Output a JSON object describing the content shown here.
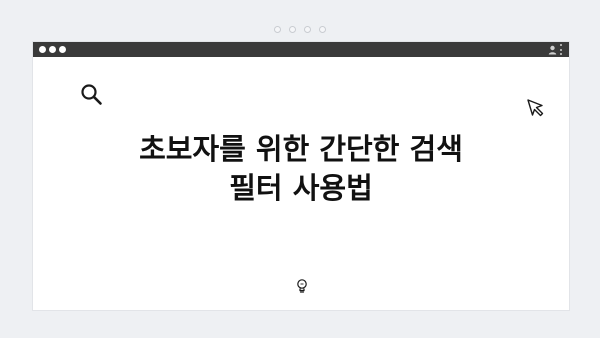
{
  "colors": {
    "background": "#f0f2f5",
    "window": "#ffffff",
    "titlebar": "#3a3a3a",
    "text": "#111111"
  },
  "titlebar": {
    "window_controls": [
      "dot",
      "dot",
      "dot"
    ],
    "right_icons": [
      "user-icon",
      "kebab-menu-icon"
    ]
  },
  "content": {
    "headline_line1": "초보자를 위한 간단한 검색",
    "headline_line2": "필터 사용법",
    "icons": [
      "search-icon",
      "cursor-icon",
      "lightbulb-icon"
    ]
  }
}
